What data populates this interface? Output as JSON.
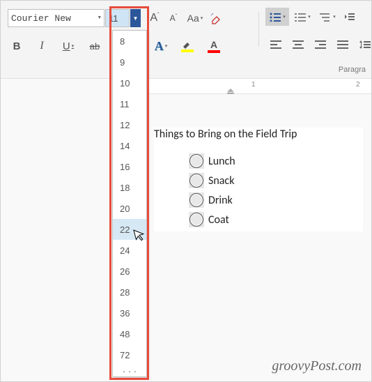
{
  "ribbon": {
    "font_name": "Courier New",
    "font_size": "11",
    "grow_label": "A",
    "shrink_label": "A",
    "case_label": "Aa",
    "bold": "B",
    "italic": "I",
    "underline": "U",
    "strike": "ab",
    "texteffects": "A",
    "highlight": "A",
    "fontcolor": "A",
    "paragraph_group": "Paragra"
  },
  "size_dropdown": {
    "items": [
      "8",
      "9",
      "10",
      "11",
      "12",
      "14",
      "16",
      "18",
      "20",
      "22",
      "24",
      "26",
      "28",
      "36",
      "48",
      "72"
    ],
    "hover_index": 9
  },
  "document": {
    "title": "Things to Bring on the Field Trip",
    "bullets": [
      "Lunch",
      "Snack",
      "Drink",
      "Coat"
    ]
  },
  "ruler": {
    "mark1": "1",
    "mark2": "2"
  },
  "watermark": "groovyPost.com"
}
